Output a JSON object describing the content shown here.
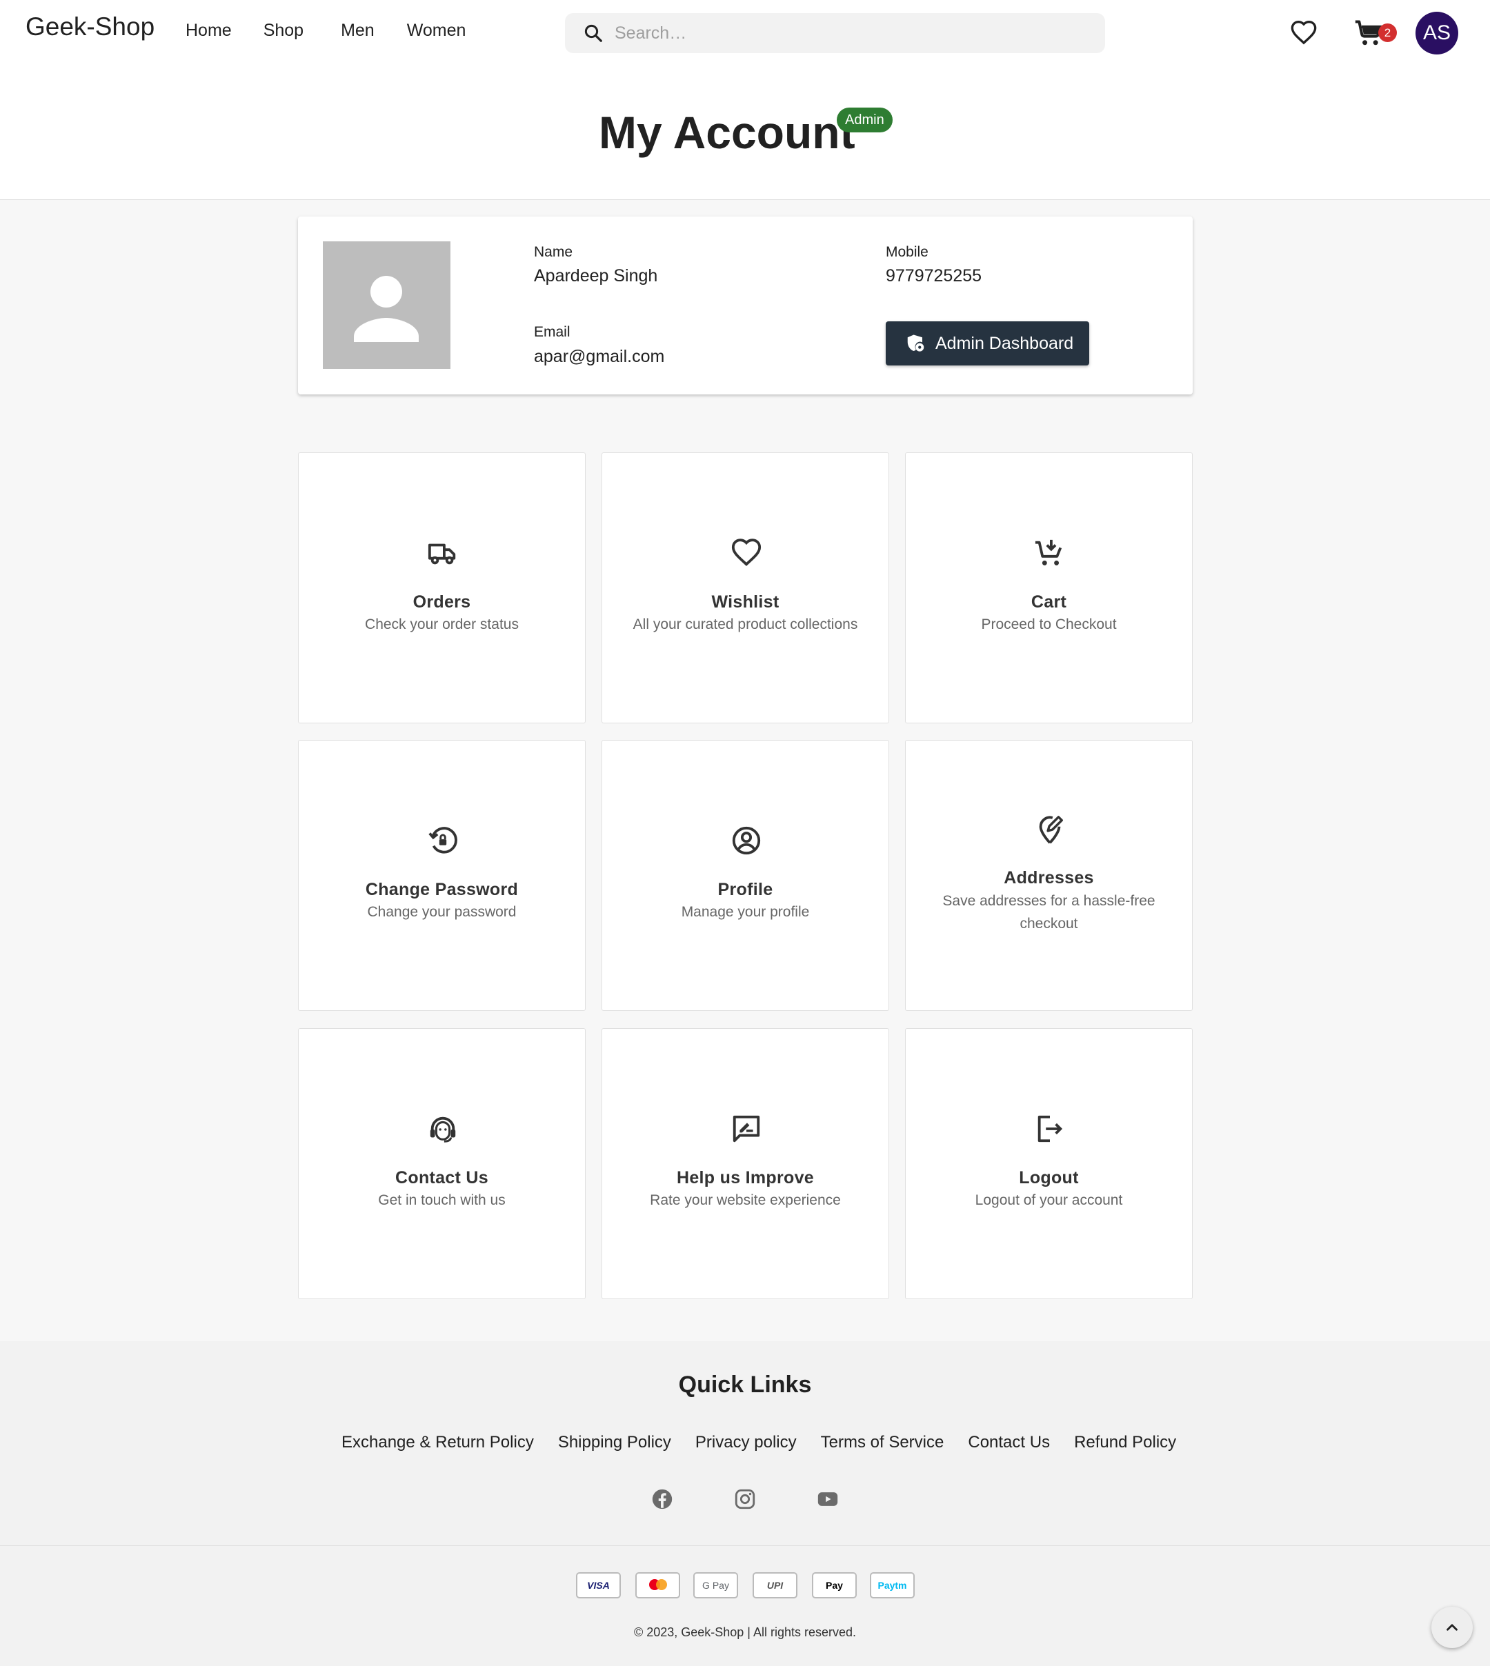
{
  "header": {
    "logo": "Geek-Shop",
    "nav": [
      "Home",
      "Shop",
      "Men",
      "Women"
    ],
    "search_placeholder": "Search…",
    "search_value": "",
    "cart_count": "2",
    "avatar_initials": "AS",
    "avatar_color": "#2a0f62",
    "icons": [
      "search-icon",
      "heart-icon",
      "cart-icon"
    ]
  },
  "title": {
    "text": "My Account",
    "role_badge": "Admin",
    "role_badge_color": "#2e7d32"
  },
  "profile": {
    "name_label": "Name",
    "name": "Apardeep Singh",
    "mobile_label": "Mobile",
    "mobile": "9779725255",
    "email_label": "Email",
    "email": "apar@gmail.com",
    "admin_button": "Admin Dashboard",
    "admin_button_color": "#263340"
  },
  "tiles": [
    {
      "icon": "truck-icon",
      "title": "Orders",
      "subtitle": "Check your order status"
    },
    {
      "icon": "heart-icon",
      "title": "Wishlist",
      "subtitle": "All your curated product collections"
    },
    {
      "icon": "cart-add-icon",
      "title": "Cart",
      "subtitle": "Proceed to Checkout"
    },
    {
      "icon": "lock-reset-icon",
      "title": "Change Password",
      "subtitle": "Change your password"
    },
    {
      "icon": "account-circle-icon",
      "title": "Profile",
      "subtitle": "Manage your profile"
    },
    {
      "icon": "location-edit-icon",
      "title": "Addresses",
      "subtitle": "Save addresses for a hassle-free checkout"
    },
    {
      "icon": "support-agent-icon",
      "title": "Contact Us",
      "subtitle": "Get in touch with us"
    },
    {
      "icon": "feedback-icon",
      "title": "Help us Improve",
      "subtitle": "Rate your website experience"
    },
    {
      "icon": "logout-icon",
      "title": "Logout",
      "subtitle": "Logout of your account"
    }
  ],
  "footer": {
    "quick_links_title": "Quick Links",
    "links": [
      "Exchange & Return Policy",
      "Shipping Policy",
      "Privacy policy",
      "Terms of Service",
      "Contact Us",
      "Refund Policy"
    ],
    "social": [
      "facebook-icon",
      "instagram-icon",
      "youtube-icon"
    ],
    "payments": [
      {
        "name": "visa-logo",
        "label": "VISA"
      },
      {
        "name": "mastercard-logo",
        "label": ""
      },
      {
        "name": "google-pay-logo",
        "label": "G Pay"
      },
      {
        "name": "upi-logo",
        "label": "UPI"
      },
      {
        "name": "apple-pay-logo",
        "label": "Pay"
      },
      {
        "name": "paytm-logo",
        "label": "Paytm"
      }
    ],
    "copyright": "© 2023, Geek-Shop | All rights reserved."
  }
}
